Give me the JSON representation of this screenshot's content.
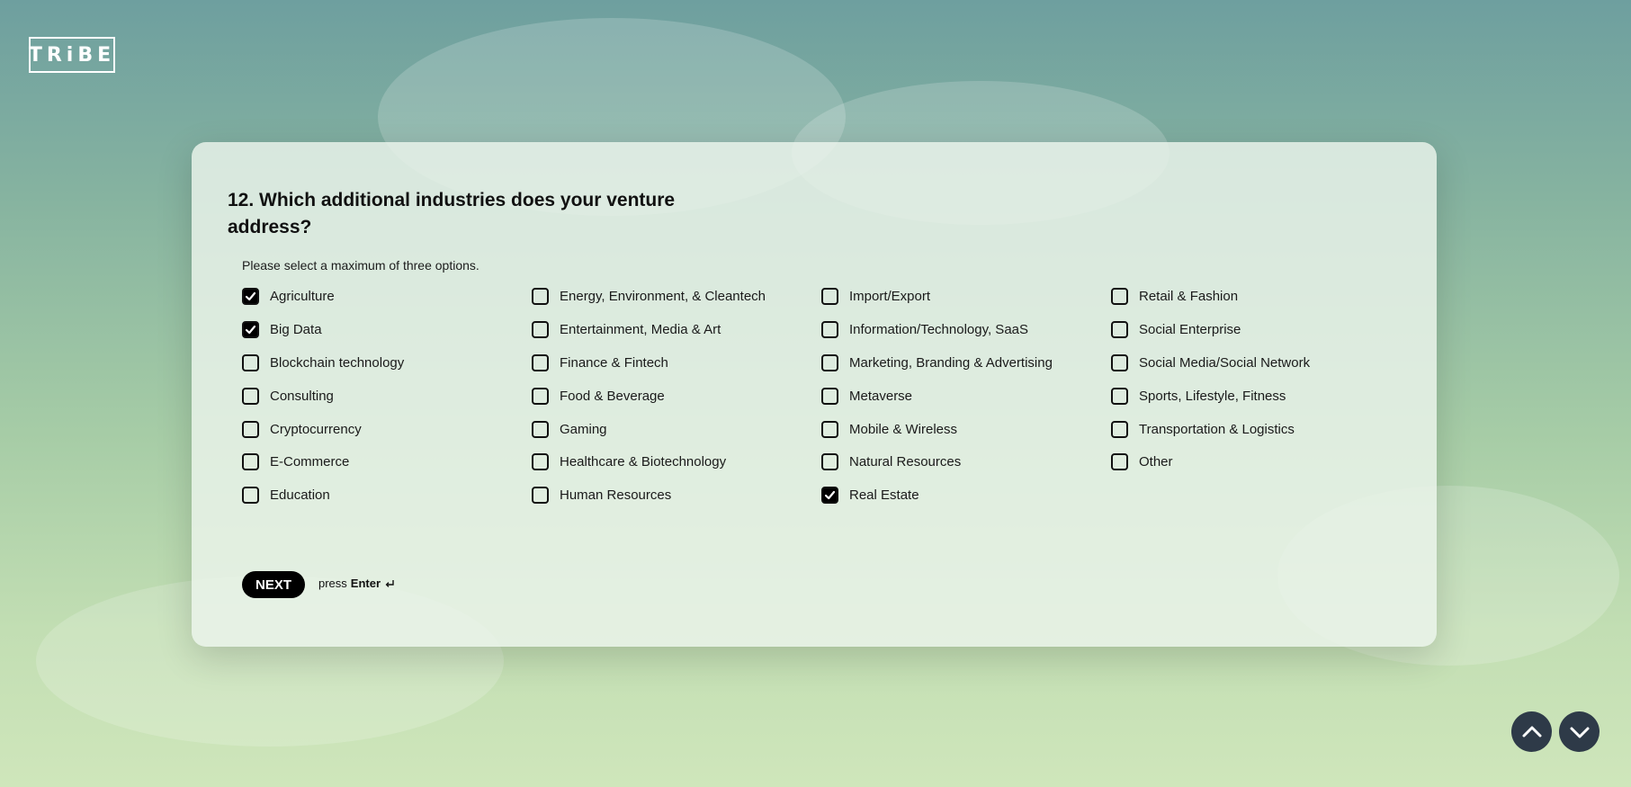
{
  "logo": {
    "text": "TRiBE"
  },
  "question": {
    "title": "12. Which additional industries does your venture address?",
    "hint": "Please select a maximum of three options."
  },
  "options": [
    {
      "label": "Agriculture",
      "checked": true
    },
    {
      "label": "Energy, Environment, & Cleantech",
      "checked": false
    },
    {
      "label": "Import/Export",
      "checked": false
    },
    {
      "label": "Retail & Fashion",
      "checked": false
    },
    {
      "label": "Big Data",
      "checked": true
    },
    {
      "label": "Entertainment, Media & Art",
      "checked": false
    },
    {
      "label": "Information/Technology, SaaS",
      "checked": false
    },
    {
      "label": "Social Enterprise",
      "checked": false
    },
    {
      "label": "Blockchain technology",
      "checked": false
    },
    {
      "label": "Finance & Fintech",
      "checked": false
    },
    {
      "label": "Marketing, Branding & Advertising",
      "checked": false
    },
    {
      "label": "Social Media/Social Network",
      "checked": false
    },
    {
      "label": "Consulting",
      "checked": false
    },
    {
      "label": "Food & Beverage",
      "checked": false
    },
    {
      "label": "Metaverse",
      "checked": false
    },
    {
      "label": "Sports, Lifestyle, Fitness",
      "checked": false
    },
    {
      "label": "Cryptocurrency",
      "checked": false
    },
    {
      "label": "Gaming",
      "checked": false
    },
    {
      "label": "Mobile & Wireless",
      "checked": false
    },
    {
      "label": "Transportation & Logistics",
      "checked": false
    },
    {
      "label": "E-Commerce",
      "checked": false
    },
    {
      "label": "Healthcare & Biotechnology",
      "checked": false
    },
    {
      "label": "Natural Resources",
      "checked": false
    },
    {
      "label": "Other",
      "checked": false
    },
    {
      "label": "Education",
      "checked": false
    },
    {
      "label": "Human Resources",
      "checked": false
    },
    {
      "label": "Real Estate",
      "checked": true
    }
  ],
  "actions": {
    "next_label": "NEXT",
    "press_text": "press",
    "key_text": "Enter",
    "enter_icon": "enter-key-icon"
  },
  "navigation": {
    "up_icon": "chevron-up-icon",
    "down_icon": "chevron-down-icon"
  },
  "colors": {
    "card_background": "#ecf4ec",
    "checkbox_checked": "#000000",
    "next_button": "#000000",
    "nav_button": "#2e3a48"
  }
}
